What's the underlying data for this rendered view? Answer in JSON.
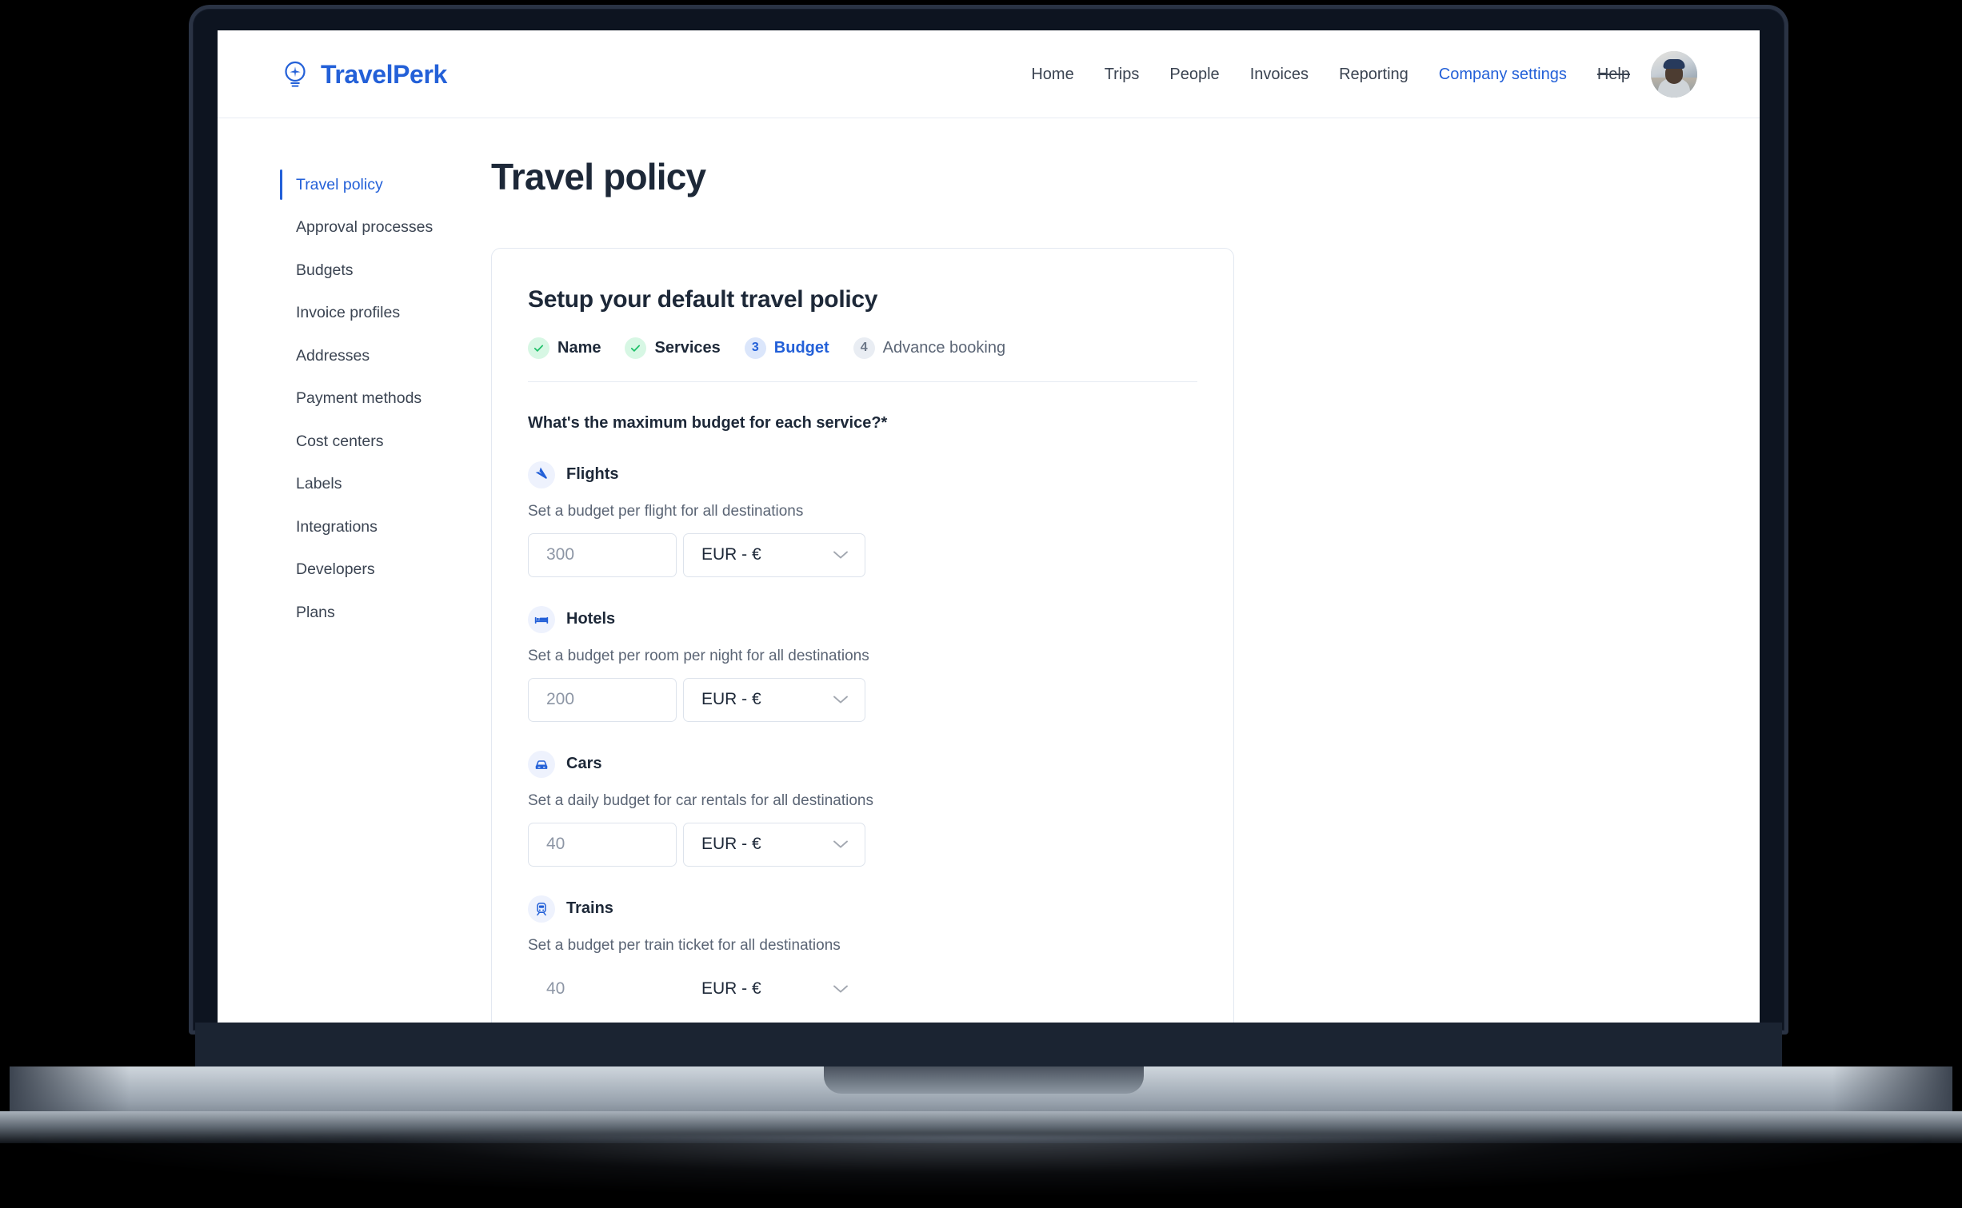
{
  "header": {
    "brand_name": "TravelPerk",
    "brand_icon": "lightbulb-airplane-logo-icon",
    "nav": [
      {
        "label": "Home",
        "active": false,
        "struck": false
      },
      {
        "label": "Trips",
        "active": false,
        "struck": false
      },
      {
        "label": "People",
        "active": false,
        "struck": false
      },
      {
        "label": "Invoices",
        "active": false,
        "struck": false
      },
      {
        "label": "Reporting",
        "active": false,
        "struck": false
      },
      {
        "label": "Company settings",
        "active": true,
        "struck": false
      },
      {
        "label": "Help",
        "active": false,
        "struck": true
      }
    ],
    "avatar_alt": "user-avatar"
  },
  "sidebar": {
    "items": [
      {
        "label": "Travel policy",
        "active": true
      },
      {
        "label": "Approval processes",
        "active": false
      },
      {
        "label": "Budgets",
        "active": false
      },
      {
        "label": "Invoice profiles",
        "active": false
      },
      {
        "label": "Addresses",
        "active": false
      },
      {
        "label": "Payment methods",
        "active": false
      },
      {
        "label": "Cost centers",
        "active": false
      },
      {
        "label": "Labels",
        "active": false
      },
      {
        "label": "Integrations",
        "active": false
      },
      {
        "label": "Developers",
        "active": false
      },
      {
        "label": "Plans",
        "active": false
      }
    ]
  },
  "main": {
    "page_title": "Travel policy",
    "card_title": "Setup your default travel policy",
    "steps": [
      {
        "number": "1",
        "label": "Name",
        "state": "done"
      },
      {
        "number": "2",
        "label": "Services",
        "state": "done"
      },
      {
        "number": "3",
        "label": "Budget",
        "state": "current"
      },
      {
        "number": "4",
        "label": "Advance booking",
        "state": "upcoming"
      }
    ],
    "budget_question": "What's the maximum budget for each service?*",
    "services": [
      {
        "name": "Flights",
        "icon": "airplane-icon",
        "description": "Set a budget per flight for all destinations",
        "amount": "300",
        "amount_placeholder": "300",
        "currency": "EUR - €"
      },
      {
        "name": "Hotels",
        "icon": "bed-icon",
        "description": "Set a budget per room per night for all destinations",
        "amount": "200",
        "amount_placeholder": "200",
        "currency": "EUR - €"
      },
      {
        "name": "Cars",
        "icon": "car-icon",
        "description": "Set a daily budget for car rentals for all destinations",
        "amount": "40",
        "amount_placeholder": "40",
        "currency": "EUR - €"
      },
      {
        "name": "Trains",
        "icon": "train-icon",
        "description": "Set a budget per train ticket for all destinations",
        "amount": "40",
        "amount_placeholder": "40",
        "currency": "EUR - €"
      }
    ]
  },
  "colors": {
    "brand_blue": "#2360d8",
    "text_dark": "#1d2838",
    "text_muted": "#5b6575",
    "border": "#e3e8f1",
    "success_green": "#21c16b",
    "banner_bg": "#eef1fc"
  }
}
